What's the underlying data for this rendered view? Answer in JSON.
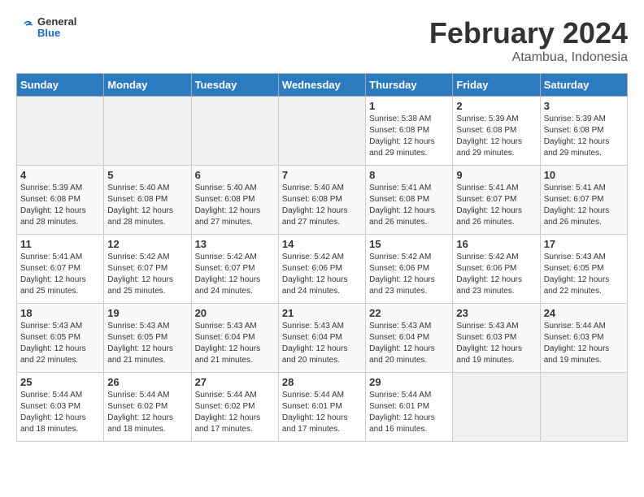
{
  "logo": {
    "line1": "General",
    "line2": "Blue"
  },
  "title": "February 2024",
  "subtitle": "Atambua, Indonesia",
  "weekdays": [
    "Sunday",
    "Monday",
    "Tuesday",
    "Wednesday",
    "Thursday",
    "Friday",
    "Saturday"
  ],
  "weeks": [
    [
      {
        "day": "",
        "info": ""
      },
      {
        "day": "",
        "info": ""
      },
      {
        "day": "",
        "info": ""
      },
      {
        "day": "",
        "info": ""
      },
      {
        "day": "1",
        "info": "Sunrise: 5:38 AM\nSunset: 6:08 PM\nDaylight: 12 hours\nand 29 minutes."
      },
      {
        "day": "2",
        "info": "Sunrise: 5:39 AM\nSunset: 6:08 PM\nDaylight: 12 hours\nand 29 minutes."
      },
      {
        "day": "3",
        "info": "Sunrise: 5:39 AM\nSunset: 6:08 PM\nDaylight: 12 hours\nand 29 minutes."
      }
    ],
    [
      {
        "day": "4",
        "info": "Sunrise: 5:39 AM\nSunset: 6:08 PM\nDaylight: 12 hours\nand 28 minutes."
      },
      {
        "day": "5",
        "info": "Sunrise: 5:40 AM\nSunset: 6:08 PM\nDaylight: 12 hours\nand 28 minutes."
      },
      {
        "day": "6",
        "info": "Sunrise: 5:40 AM\nSunset: 6:08 PM\nDaylight: 12 hours\nand 27 minutes."
      },
      {
        "day": "7",
        "info": "Sunrise: 5:40 AM\nSunset: 6:08 PM\nDaylight: 12 hours\nand 27 minutes."
      },
      {
        "day": "8",
        "info": "Sunrise: 5:41 AM\nSunset: 6:08 PM\nDaylight: 12 hours\nand 26 minutes."
      },
      {
        "day": "9",
        "info": "Sunrise: 5:41 AM\nSunset: 6:07 PM\nDaylight: 12 hours\nand 26 minutes."
      },
      {
        "day": "10",
        "info": "Sunrise: 5:41 AM\nSunset: 6:07 PM\nDaylight: 12 hours\nand 26 minutes."
      }
    ],
    [
      {
        "day": "11",
        "info": "Sunrise: 5:41 AM\nSunset: 6:07 PM\nDaylight: 12 hours\nand 25 minutes."
      },
      {
        "day": "12",
        "info": "Sunrise: 5:42 AM\nSunset: 6:07 PM\nDaylight: 12 hours\nand 25 minutes."
      },
      {
        "day": "13",
        "info": "Sunrise: 5:42 AM\nSunset: 6:07 PM\nDaylight: 12 hours\nand 24 minutes."
      },
      {
        "day": "14",
        "info": "Sunrise: 5:42 AM\nSunset: 6:06 PM\nDaylight: 12 hours\nand 24 minutes."
      },
      {
        "day": "15",
        "info": "Sunrise: 5:42 AM\nSunset: 6:06 PM\nDaylight: 12 hours\nand 23 minutes."
      },
      {
        "day": "16",
        "info": "Sunrise: 5:42 AM\nSunset: 6:06 PM\nDaylight: 12 hours\nand 23 minutes."
      },
      {
        "day": "17",
        "info": "Sunrise: 5:43 AM\nSunset: 6:05 PM\nDaylight: 12 hours\nand 22 minutes."
      }
    ],
    [
      {
        "day": "18",
        "info": "Sunrise: 5:43 AM\nSunset: 6:05 PM\nDaylight: 12 hours\nand 22 minutes."
      },
      {
        "day": "19",
        "info": "Sunrise: 5:43 AM\nSunset: 6:05 PM\nDaylight: 12 hours\nand 21 minutes."
      },
      {
        "day": "20",
        "info": "Sunrise: 5:43 AM\nSunset: 6:04 PM\nDaylight: 12 hours\nand 21 minutes."
      },
      {
        "day": "21",
        "info": "Sunrise: 5:43 AM\nSunset: 6:04 PM\nDaylight: 12 hours\nand 20 minutes."
      },
      {
        "day": "22",
        "info": "Sunrise: 5:43 AM\nSunset: 6:04 PM\nDaylight: 12 hours\nand 20 minutes."
      },
      {
        "day": "23",
        "info": "Sunrise: 5:43 AM\nSunset: 6:03 PM\nDaylight: 12 hours\nand 19 minutes."
      },
      {
        "day": "24",
        "info": "Sunrise: 5:44 AM\nSunset: 6:03 PM\nDaylight: 12 hours\nand 19 minutes."
      }
    ],
    [
      {
        "day": "25",
        "info": "Sunrise: 5:44 AM\nSunset: 6:03 PM\nDaylight: 12 hours\nand 18 minutes."
      },
      {
        "day": "26",
        "info": "Sunrise: 5:44 AM\nSunset: 6:02 PM\nDaylight: 12 hours\nand 18 minutes."
      },
      {
        "day": "27",
        "info": "Sunrise: 5:44 AM\nSunset: 6:02 PM\nDaylight: 12 hours\nand 17 minutes."
      },
      {
        "day": "28",
        "info": "Sunrise: 5:44 AM\nSunset: 6:01 PM\nDaylight: 12 hours\nand 17 minutes."
      },
      {
        "day": "29",
        "info": "Sunrise: 5:44 AM\nSunset: 6:01 PM\nDaylight: 12 hours\nand 16 minutes."
      },
      {
        "day": "",
        "info": ""
      },
      {
        "day": "",
        "info": ""
      }
    ]
  ]
}
